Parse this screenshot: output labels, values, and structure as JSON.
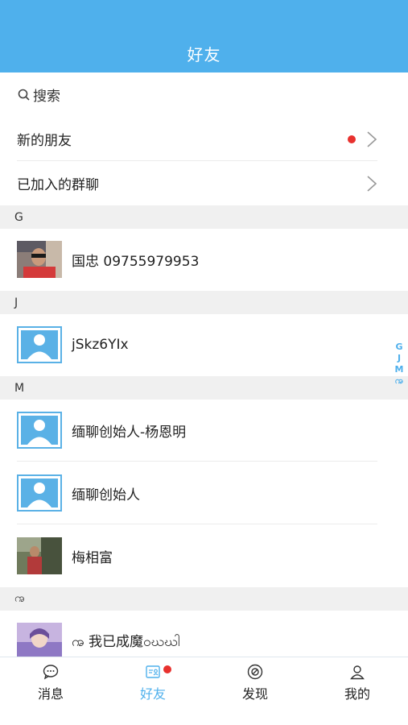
{
  "header": {
    "title": "好友"
  },
  "search": {
    "label": "搜索",
    "icon": "search-icon"
  },
  "menu": [
    {
      "label": "新的朋友",
      "has_badge": true
    },
    {
      "label": "已加入的群聊",
      "has_badge": false
    }
  ],
  "sections": [
    {
      "letter": "G",
      "contacts": [
        {
          "name": "国忠 09755979953",
          "avatar": "photo"
        }
      ]
    },
    {
      "letter": "J",
      "contacts": [
        {
          "name": "jSkz6YIx",
          "avatar": "default"
        }
      ]
    },
    {
      "letter": "M",
      "contacts": [
        {
          "name": "缅聊创始人-杨恩明",
          "avatar": "default"
        },
        {
          "name": "缅聊创始人",
          "avatar": "default"
        },
        {
          "name": "梅相富",
          "avatar": "photo"
        }
      ]
    },
    {
      "letter": "ꩠ",
      "contacts": [
        {
          "name": "ꩠ 我已成魔ဝဃဃါ",
          "avatar": "photo"
        }
      ]
    }
  ],
  "index_bar": [
    "G",
    "J",
    "M",
    "ꩠ"
  ],
  "tabs": [
    {
      "label": "消息",
      "icon": "chat-bubble-icon",
      "active": false
    },
    {
      "label": "好友",
      "icon": "contacts-icon",
      "active": true,
      "badge": true
    },
    {
      "label": "发现",
      "icon": "discover-icon",
      "active": false
    },
    {
      "label": "我的",
      "icon": "profile-icon",
      "active": false
    }
  ],
  "colors": {
    "accent": "#4fb0ec",
    "badge": "#e8312e",
    "section_bg": "#f0f0f0"
  }
}
